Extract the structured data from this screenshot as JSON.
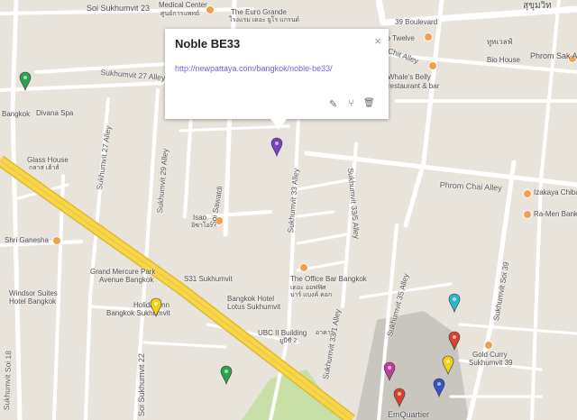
{
  "popup": {
    "title": "Noble BE33",
    "link": "http://newpattaya.com/bangkok/noble-be33/",
    "close": "×",
    "edit_icon": "✎",
    "style_icon": "⑂",
    "delete_icon": "🗑"
  },
  "labels": {
    "soi23": "Soi Sukhumvit 23",
    "medical": "Medical Center",
    "medical_th": "ศูนย์การแพทย์",
    "euro": "The Euro Grande",
    "euro_th": "โรงแรม เดอะ ยูโร แกรนด์",
    "sukh_th": "สุขุมวิท",
    "blvd39": "39 Boulevard",
    "twelve": "Too Twelve",
    "twelve_th": "ทูทเวลฟ์",
    "phrom_sak": "Phrom Sak A",
    "bio": "Bio House",
    "chit": "Chit Alley",
    "whale": "Whale's Belly",
    "whale2": "restaurant & bar",
    "s27": "Sukhumvit 27 Alley",
    "bangkok": "Bangkok",
    "divana": "Divana Spa",
    "glass": "Glass House",
    "glass_th": "กลาส เฮ้าส์",
    "phrom_chai": "Phrom Chai Alley",
    "izakaya": "Izakaya Chiba-C",
    "ramen": "Ra-Men Bankara",
    "isao": "Isao",
    "isao_th": "อิซาโอะ",
    "shri": "Shri Ganesha",
    "grand1": "Grand Mercure Park",
    "grand2": "Avenue Bangkok",
    "s31": "S31 Sukhumvit",
    "office": "The Office Bar Bangkok",
    "office_th": "เดอะ ออฟฟิศ",
    "office_th2": "บาร์ แบงค์ คอก",
    "windsor1": "Windsor Suites",
    "windsor2": "Hotel Bangkok",
    "holiday1": "Holiday Inn",
    "holiday2": "Bangkok Sukhumvit",
    "lotus1": "Bangkok Hotel",
    "lotus2": "Lotus Sukhumvit",
    "ubc": "UBC II Building",
    "ubc_th": "อาคาร",
    "ubc_th2": "ยูบีซี 2",
    "gold1": "Gold Curry",
    "gold2": "Sukhumvit 39",
    "emq": "EmQuartier",
    "road_s18": "Sukhumvit Soi 18",
    "road_s22": "Soi Sukhumvit 22",
    "road_s27": "Sukhumvit 27 Alley",
    "road_s29": "Sukhumvit 29 Alley",
    "road_sawatdi": "Soi Sawatdi",
    "road_s33": "Sukhumvit 33 Alley",
    "road_s335": "Sukhumvit 33/5 Alley",
    "road_s331": "Sukhumvit 33/1 Alley",
    "road_s35": "Sukhumvit 35 Alley",
    "road_s39": "Sukhumvit Soi 39"
  },
  "colors": {
    "land": "#e8e4dc",
    "road": "#ffffff",
    "highway": "#f7d64a",
    "park": "#c8dfa8",
    "mall": "#c9c5bf"
  },
  "pins": [
    {
      "name": "pin-purple-noble",
      "color": "#7b3fc4"
    },
    {
      "name": "pin-green-1",
      "color": "#2aa34a"
    },
    {
      "name": "pin-green-2",
      "color": "#2aa34a"
    },
    {
      "name": "pin-yellow-1",
      "color": "#f2d11a"
    },
    {
      "name": "pin-cyan",
      "color": "#2ab8c8"
    },
    {
      "name": "pin-red-1",
      "color": "#d9412e"
    },
    {
      "name": "pin-red-2",
      "color": "#d9412e"
    },
    {
      "name": "pin-magenta",
      "color": "#c33c9a"
    },
    {
      "name": "pin-yellow-2",
      "color": "#f2d11a"
    },
    {
      "name": "pin-blue",
      "color": "#3553c8"
    }
  ]
}
